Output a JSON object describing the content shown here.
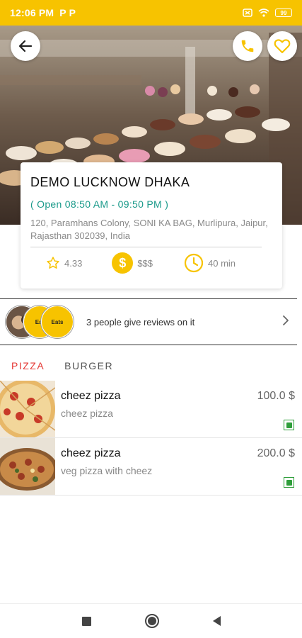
{
  "status_bar": {
    "time": "12:06 PM",
    "notification_icons": [
      "P",
      "P"
    ],
    "battery": "99",
    "colors": {
      "background": "#f7c300"
    }
  },
  "header": {
    "back_icon": "arrow-left-icon",
    "call_icon": "phone-icon",
    "favorite_icon": "heart-icon"
  },
  "restaurant": {
    "name": "DEMO LUCKNOW DHAKA",
    "hours": "( Open 08:50 AM - 09:50 PM )",
    "address": "120, Paramhans Colony, SONI KA BAG, Murlipura, Jaipur, Rajasthan 302039, India",
    "rating": "4.33",
    "price_level": "$$$",
    "coin_symbol": "$",
    "delivery_time": "40 min"
  },
  "reviews": {
    "text": "3 people give reviews on it",
    "avatar_labels": [
      "Eat",
      "Eats"
    ]
  },
  "tabs": [
    {
      "label": "PIZZA",
      "active": true
    },
    {
      "label": "BURGER",
      "active": false
    }
  ],
  "menu": {
    "items": [
      {
        "name": "cheez pizza",
        "description": "cheez pizza",
        "price": "100.0 $",
        "veg": true
      },
      {
        "name": "cheez pizza",
        "description": "veg pizza with cheez",
        "price": "200.0 $",
        "veg": true
      }
    ]
  },
  "colors": {
    "accent": "#f7c300",
    "active_tab": "#e53935",
    "hours_text": "#1a9a8a",
    "veg_green": "#2e9e3a"
  }
}
